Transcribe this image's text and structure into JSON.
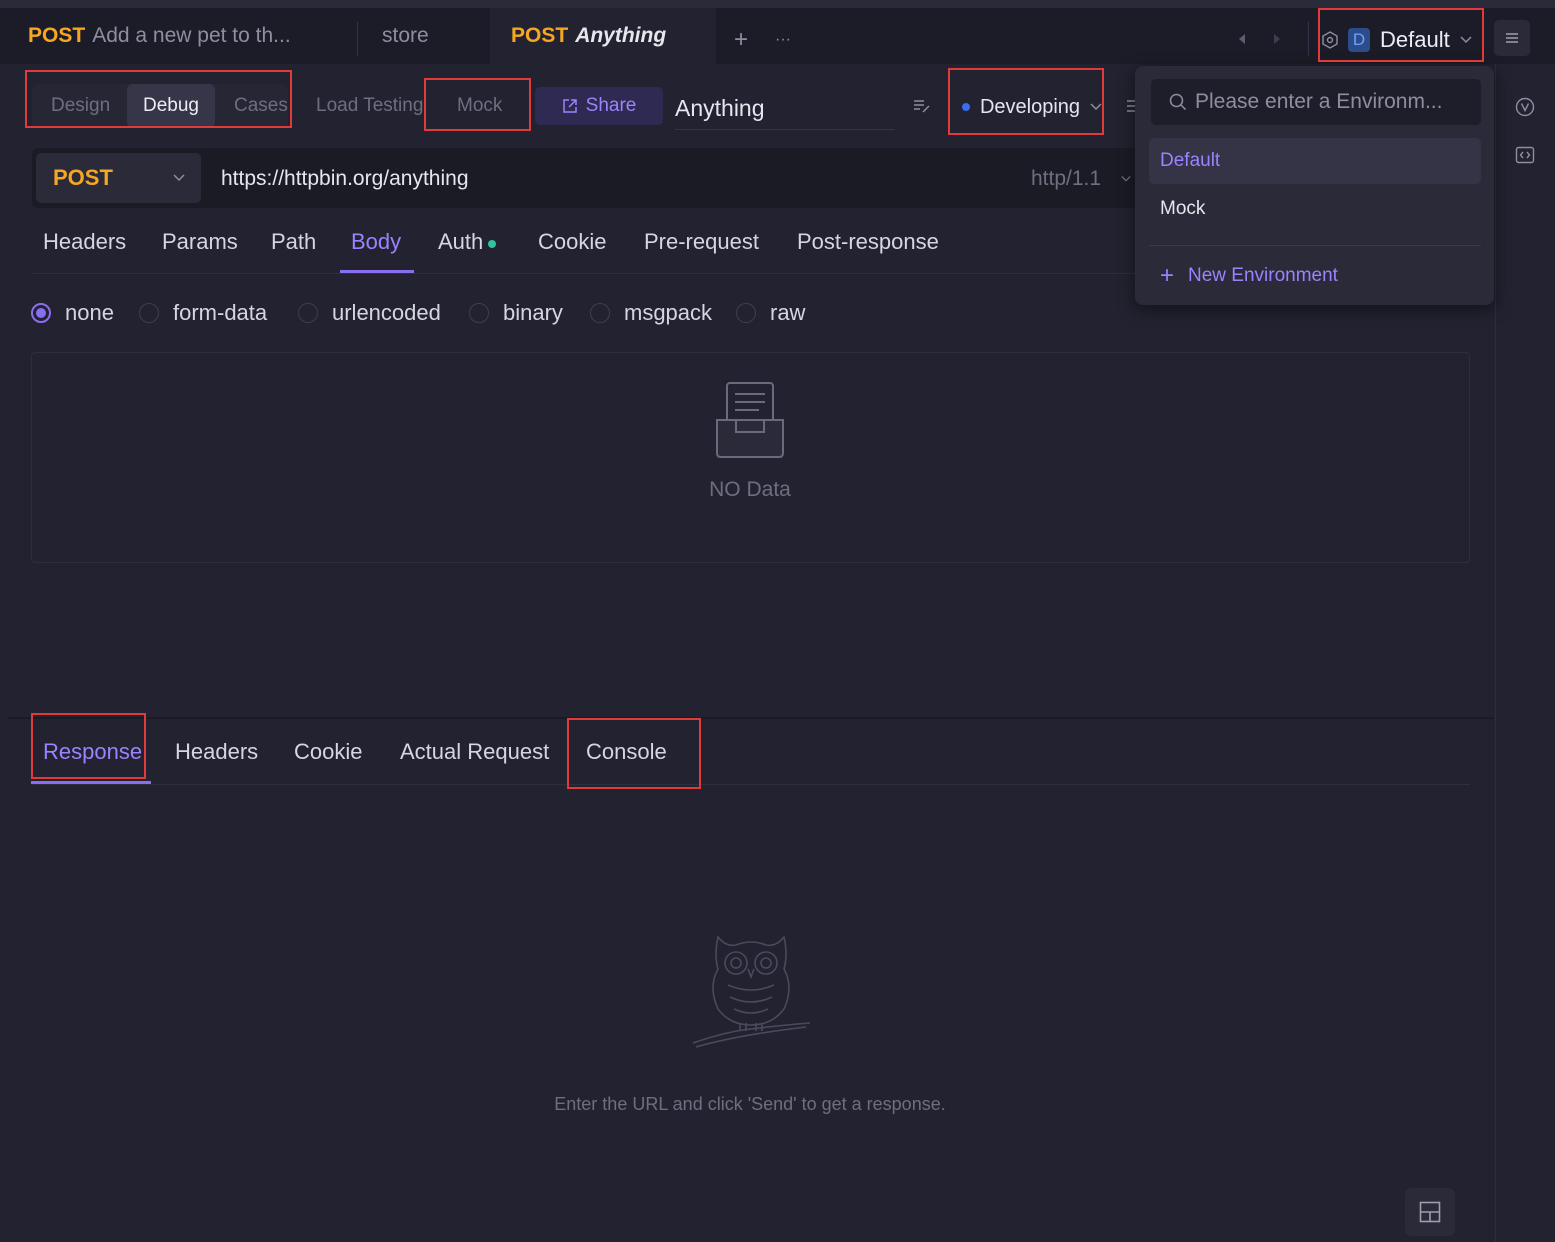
{
  "tabs": [
    {
      "method": "POST",
      "title": "Add a new pet to th..."
    },
    {
      "method": "",
      "title": "store"
    },
    {
      "method": "POST",
      "title": "Anything"
    }
  ],
  "tab_actions": {
    "add": "+",
    "more": "···"
  },
  "environment": {
    "badge": "D",
    "name": "Default"
  },
  "subtabs": {
    "design": "Design",
    "debug": "Debug",
    "cases": "Cases",
    "load_testing": "Load Testing",
    "mock": "Mock",
    "share": "Share"
  },
  "endpoint_name": "Anything",
  "status": "Developing",
  "request": {
    "method": "POST",
    "url": "https://httpbin.org/anything",
    "protocol": "http/1.1"
  },
  "request_tabs": [
    "Headers",
    "Params",
    "Path",
    "Body",
    "Auth",
    "Cookie",
    "Pre-request",
    "Post-response"
  ],
  "body_types": [
    "none",
    "form-data",
    "urlencoded",
    "binary",
    "msgpack",
    "raw"
  ],
  "body_empty": "NO Data",
  "response_tabs": [
    "Response",
    "Headers",
    "Cookie",
    "Actual Request",
    "Console"
  ],
  "response_empty": "Enter the URL and click 'Send' to get a response.",
  "env_dropdown": {
    "placeholder": "Please enter a Environm...",
    "items": [
      "Default",
      "Mock"
    ],
    "new_label": "New Environment"
  },
  "colors": {
    "accent": "#8a6ef0",
    "method": "#f5a623",
    "highlight": "#e03a3a",
    "status_dot": "#3b6cf5",
    "auth_dot": "#2ec4a0"
  }
}
